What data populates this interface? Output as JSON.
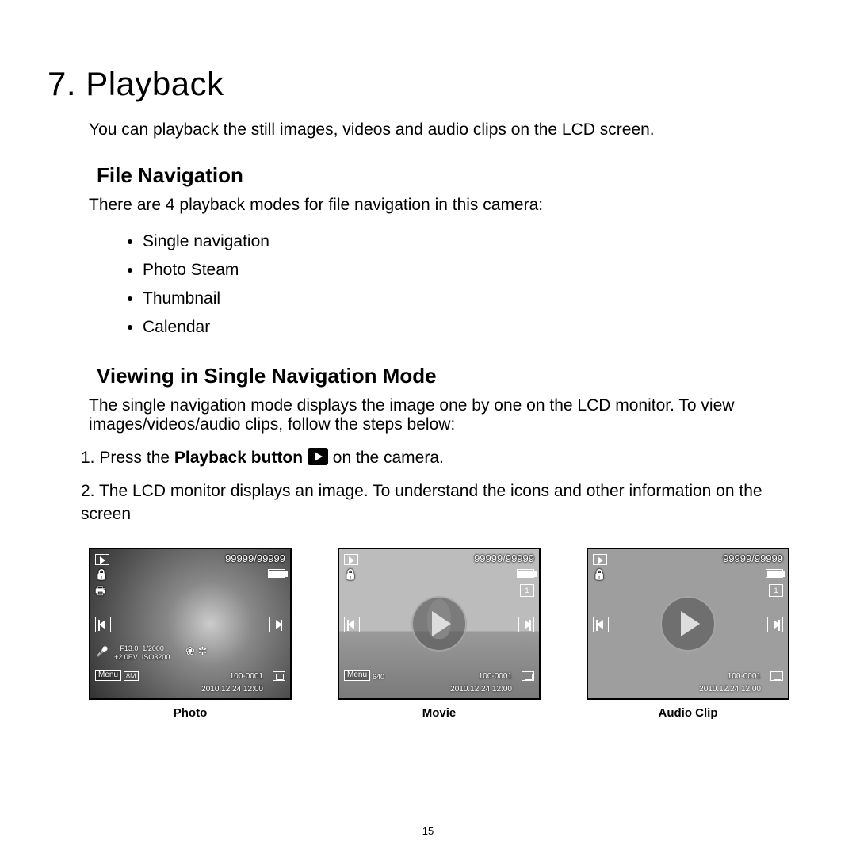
{
  "chapter_title": "7. Playback",
  "intro": "You can playback the still images, videos and audio clips on the LCD screen.",
  "section1": {
    "heading": "File Navigation",
    "text": "There are 4 playback modes for file navigation in this camera:",
    "modes": [
      "Single navigation",
      "Photo Steam",
      "Thumbnail",
      "Calendar"
    ]
  },
  "section2": {
    "heading": "Viewing in Single Navigation Mode",
    "text": "The single navigation mode displays the image one by one on the LCD monitor. To view images/videos/audio clips, follow the steps below:",
    "step1_pre": "1.  Press the ",
    "step1_bold": "Playback button",
    "step1_post": " on the camera.",
    "step2": "2.  The LCD monitor displays an image. To understand the icons and other information on the screen"
  },
  "screens": {
    "counter": "99999/99999",
    "menu": "Menu",
    "fileno": "100-0001",
    "datetime": "2010.12.24 12:00",
    "photo": {
      "caption": "Photo",
      "size": "8M",
      "aperture": "F13.0",
      "shutter": "1/2000",
      "ev": "+2.0EV",
      "iso": "ISO3200"
    },
    "movie": {
      "caption": "Movie",
      "size": "640"
    },
    "audio": {
      "caption": "Audio Clip"
    }
  },
  "page_number": "15"
}
